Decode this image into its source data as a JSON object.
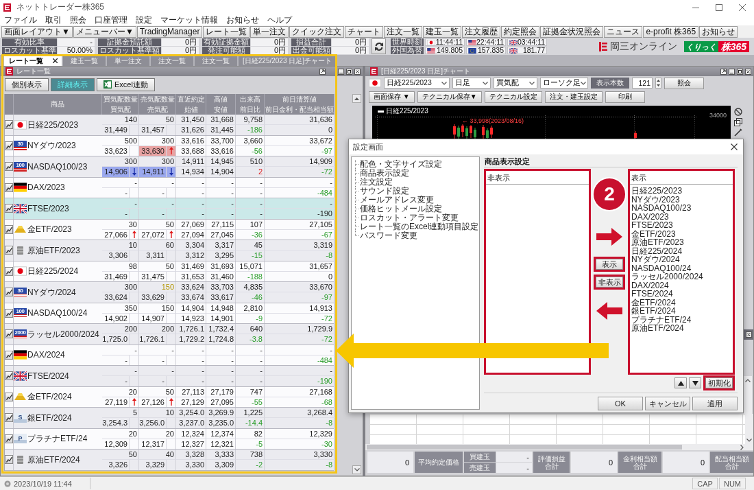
{
  "window": {
    "title": "ネットトレーダー株365"
  },
  "menu": [
    "ファイル",
    "取引",
    "照会",
    "口座管理",
    "設定",
    "マーケット情報",
    "お知らせ",
    "ヘルプ"
  ],
  "toolbar": [
    "画面レイアウト▼",
    "メニューバー▼",
    "TradingManager",
    "レート一覧",
    "単一注文",
    "クイック注文",
    "チャート",
    "注文一覧",
    "建玉一覧",
    "注文履歴",
    "約定照会",
    "証拠金状況照会",
    "ニュース",
    "e-profit 株365",
    "お知らせ"
  ],
  "account": [
    {
      "label": "有効比率",
      "value": "-"
    },
    {
      "label": "証拠金預託額",
      "value": "0円"
    },
    {
      "label": "有効証拠金額",
      "value": "0円"
    },
    {
      "label": "損益合計",
      "value": "0円"
    },
    {
      "label": "ロスカット基準",
      "value": "50.00%"
    },
    {
      "label": "ロスカット基準額",
      "value": "0円"
    },
    {
      "label": "発注可能額",
      "value": "0円"
    },
    {
      "label": "出金可能額",
      "value": "0円"
    }
  ],
  "world_clock": {
    "label": "世界時刻",
    "items": [
      {
        "kind": "japan",
        "value": "11:44:11"
      },
      {
        "kind": "usa",
        "value": "22:44:11"
      },
      {
        "kind": "uk",
        "value": "03:44:11"
      }
    ]
  },
  "forex": {
    "label": "外国為替",
    "items": [
      {
        "kind": "usa",
        "value": "149.805"
      },
      {
        "kind": "eu",
        "value": "157.835"
      },
      {
        "kind": "uk",
        "value": "181.77"
      }
    ]
  },
  "brand": {
    "name": "岡三オンライン",
    "product_prefix": "くりっく",
    "product_name": "株365"
  },
  "tabs": [
    {
      "label": "レート一覧",
      "selected": true,
      "closable": true
    },
    {
      "label": "建玉一覧",
      "selected": false,
      "closable": false
    },
    {
      "label": "単一注文",
      "selected": false,
      "closable": false
    },
    {
      "label": "注文一覧",
      "selected": false,
      "closable": false
    },
    {
      "label": "注文一覧",
      "selected": false,
      "closable": false
    },
    {
      "label": "[日経225/2023 日足]チャート",
      "selected": false,
      "closable": false
    }
  ],
  "rate_window": {
    "title": "レート一覧",
    "view_buttons": [
      {
        "label": "個別表示",
        "selected": false
      },
      {
        "label": "詳細表示",
        "selected": true
      }
    ],
    "excel_button": "Excel連動",
    "columns": [
      {
        "top": "商品"
      },
      {
        "top": "買気配数量",
        "bottom": "買気配"
      },
      {
        "top": "売気配数量",
        "bottom": "売気配"
      },
      {
        "top": "直近約定",
        "bottom": "始値"
      },
      {
        "top": "高値",
        "bottom": "安値"
      },
      {
        "top": "出来高",
        "bottom": "前日比"
      },
      {
        "top": "前日清算値",
        "bottom": "前日金利・配当相当額"
      }
    ],
    "rows": [
      {
        "name": "日経225/2023",
        "flag": {
          "kind": "japan"
        },
        "selected": false,
        "bid_qty": "140",
        "ask_qty": "50",
        "ask_qty_flash": false,
        "last": "31,450",
        "high": "31,668",
        "volume": "9,758",
        "prev_settle": "31,636",
        "bid": {
          "value": "31,449",
          "rising": false,
          "falling": false,
          "flashing": false
        },
        "ask": {
          "value": "31,457",
          "rising": false,
          "falling": false,
          "flashing": false
        },
        "open": "31,626",
        "low": "31,445",
        "change": {
          "value": "-186",
          "rising": false,
          "falling": true
        },
        "interest": {
          "value": "0",
          "rising": false,
          "falling": false
        }
      },
      {
        "name": "NYダウ/2023",
        "flag": {
          "kind": "usa_index",
          "label": "30"
        },
        "selected": false,
        "bid_qty": "500",
        "ask_qty": "300",
        "ask_qty_flash": false,
        "last": "33,616",
        "high": "33,700",
        "volume": "3,660",
        "prev_settle": "33,672",
        "bid": {
          "value": "33,623",
          "rising": false,
          "falling": false,
          "flashing": false
        },
        "ask": {
          "value": "33,630",
          "rising": true,
          "falling": false,
          "flashing": true
        },
        "open": "33,688",
        "low": "33,616",
        "change": {
          "value": "-56",
          "rising": false,
          "falling": true
        },
        "interest": {
          "value": "-97",
          "rising": false,
          "falling": true
        }
      },
      {
        "name": "NASDAQ100/23",
        "flag": {
          "kind": "usa_index",
          "label": "100"
        },
        "selected": false,
        "bid_qty": "300",
        "ask_qty": "300",
        "ask_qty_flash": false,
        "last": "14,911",
        "high": "14,945",
        "volume": "510",
        "prev_settle": "14,909",
        "bid": {
          "value": "14,906",
          "rising": false,
          "falling": true,
          "flashing": true
        },
        "ask": {
          "value": "14,911",
          "rising": false,
          "falling": true,
          "flashing": true
        },
        "open": "14,934",
        "low": "14,904",
        "change": {
          "value": "2",
          "rising": true,
          "falling": false
        },
        "interest": {
          "value": "-72",
          "rising": false,
          "falling": true
        }
      },
      {
        "name": "DAX/2023",
        "flag": {
          "kind": "germany"
        },
        "selected": false,
        "bid_qty": "-",
        "ask_qty": "-",
        "ask_qty_flash": false,
        "last": "-",
        "high": "-",
        "volume": "-",
        "prev_settle": "-",
        "bid": {
          "value": "-",
          "rising": false,
          "falling": false,
          "flashing": false
        },
        "ask": {
          "value": "-",
          "rising": false,
          "falling": false,
          "flashing": false
        },
        "open": "-",
        "low": "-",
        "change": {
          "value": "-",
          "rising": false,
          "falling": false
        },
        "interest": {
          "value": "-484",
          "rising": false,
          "falling": true
        }
      },
      {
        "name": "FTSE/2023",
        "flag": {
          "kind": "uk"
        },
        "selected": true,
        "bid_qty": "-",
        "ask_qty": "-",
        "ask_qty_flash": false,
        "last": "-",
        "high": "-",
        "volume": "-",
        "prev_settle": "-",
        "bid": {
          "value": "-",
          "rising": false,
          "falling": false,
          "flashing": false
        },
        "ask": {
          "value": "-",
          "rising": false,
          "falling": false,
          "flashing": false
        },
        "open": "-",
        "low": "-",
        "change": {
          "value": "-",
          "rising": false,
          "falling": false
        },
        "interest": {
          "value": "-190",
          "rising": false,
          "falling": false
        }
      },
      {
        "name": "金ETF/2023",
        "flag": {
          "kind": "gold"
        },
        "selected": false,
        "bid_qty": "30",
        "ask_qty": "50",
        "ask_qty_flash": false,
        "last": "27,069",
        "high": "27,115",
        "volume": "107",
        "prev_settle": "27,105",
        "bid": {
          "value": "27,066",
          "rising": true,
          "falling": false,
          "flashing": false
        },
        "ask": {
          "value": "27,072",
          "rising": true,
          "falling": false,
          "flashing": false
        },
        "open": "27,094",
        "low": "27,045",
        "change": {
          "value": "-36",
          "rising": false,
          "falling": true
        },
        "interest": {
          "value": "-67",
          "rising": false,
          "falling": true
        }
      },
      {
        "name": "原油ETF/2023",
        "flag": {
          "kind": "oil"
        },
        "selected": false,
        "bid_qty": "10",
        "ask_qty": "60",
        "ask_qty_flash": false,
        "last": "3,304",
        "high": "3,317",
        "volume": "45",
        "prev_settle": "3,319",
        "bid": {
          "value": "3,306",
          "rising": false,
          "falling": false,
          "flashing": false
        },
        "ask": {
          "value": "3,311",
          "rising": false,
          "falling": false,
          "flashing": false
        },
        "open": "3,312",
        "low": "3,295",
        "change": {
          "value": "-15",
          "rising": false,
          "falling": true
        },
        "interest": {
          "value": "-8",
          "rising": false,
          "falling": true
        }
      },
      {
        "name": "日経225/2024",
        "flag": {
          "kind": "japan"
        },
        "selected": false,
        "bid_qty": "98",
        "ask_qty": "50",
        "ask_qty_flash": false,
        "last": "31,469",
        "high": "31,693",
        "volume": "15,071",
        "prev_settle": "31,657",
        "bid": {
          "value": "31,469",
          "rising": false,
          "falling": false,
          "flashing": false
        },
        "ask": {
          "value": "31,475",
          "rising": false,
          "falling": false,
          "flashing": false
        },
        "open": "31,653",
        "low": "31,460",
        "change": {
          "value": "-188",
          "rising": false,
          "falling": true
        },
        "interest": {
          "value": "0",
          "rising": false,
          "falling": false
        }
      },
      {
        "name": "NYダウ/2024",
        "flag": {
          "kind": "usa_index",
          "label": "30"
        },
        "selected": false,
        "bid_qty": "300",
        "ask_qty": "150",
        "ask_qty_flash": true,
        "last": "33,624",
        "high": "33,703",
        "volume": "4,835",
        "prev_settle": "33,670",
        "bid": {
          "value": "33,624",
          "rising": false,
          "falling": false,
          "flashing": false
        },
        "ask": {
          "value": "33,629",
          "rising": false,
          "falling": false,
          "flashing": false
        },
        "open": "33,674",
        "low": "33,617",
        "change": {
          "value": "-46",
          "rising": false,
          "falling": true
        },
        "interest": {
          "value": "-97",
          "rising": false,
          "falling": true
        }
      },
      {
        "name": "NASDAQ100/24",
        "flag": {
          "kind": "usa_index",
          "label": "100"
        },
        "selected": false,
        "bid_qty": "350",
        "ask_qty": "150",
        "ask_qty_flash": false,
        "last": "14,904",
        "high": "14,948",
        "volume": "2,810",
        "prev_settle": "14,913",
        "bid": {
          "value": "14,902",
          "rising": false,
          "falling": false,
          "flashing": false
        },
        "ask": {
          "value": "14,907",
          "rising": false,
          "falling": false,
          "flashing": false
        },
        "open": "14,923",
        "low": "14,901",
        "change": {
          "value": "-9",
          "rising": false,
          "falling": true
        },
        "interest": {
          "value": "-72",
          "rising": false,
          "falling": true
        }
      },
      {
        "name": "ラッセル2000/2024",
        "flag": {
          "kind": "usa_index",
          "label": "2000"
        },
        "selected": false,
        "bid_qty": "200",
        "ask_qty": "200",
        "ask_qty_flash": false,
        "last": "1,726.1",
        "high": "1,732.4",
        "volume": "640",
        "prev_settle": "1,729.9",
        "bid": {
          "value": "1,725.0",
          "rising": false,
          "falling": false,
          "flashing": false
        },
        "ask": {
          "value": "1,726.1",
          "rising": false,
          "falling": false,
          "flashing": false
        },
        "open": "1,729.2",
        "low": "1,724.8",
        "change": {
          "value": "-3.8",
          "rising": false,
          "falling": true
        },
        "interest": {
          "value": "-72",
          "rising": false,
          "falling": true
        }
      },
      {
        "name": "DAX/2024",
        "flag": {
          "kind": "germany"
        },
        "selected": false,
        "bid_qty": "-",
        "ask_qty": "-",
        "ask_qty_flash": false,
        "last": "-",
        "high": "-",
        "volume": "-",
        "prev_settle": "-",
        "bid": {
          "value": "-",
          "rising": false,
          "falling": false,
          "flashing": false
        },
        "ask": {
          "value": "-",
          "rising": false,
          "falling": false,
          "flashing": false
        },
        "open": "-",
        "low": "-",
        "change": {
          "value": "-",
          "rising": false,
          "falling": false
        },
        "interest": {
          "value": "-484",
          "rising": false,
          "falling": true
        }
      },
      {
        "name": "FTSE/2024",
        "flag": {
          "kind": "uk"
        },
        "selected": false,
        "bid_qty": "-",
        "ask_qty": "-",
        "ask_qty_flash": false,
        "last": "-",
        "high": "-",
        "volume": "-",
        "prev_settle": "-",
        "bid": {
          "value": "-",
          "rising": false,
          "falling": false,
          "flashing": false
        },
        "ask": {
          "value": "-",
          "rising": false,
          "falling": false,
          "flashing": false
        },
        "open": "-",
        "low": "-",
        "change": {
          "value": "-",
          "rising": false,
          "falling": false
        },
        "interest": {
          "value": "-190",
          "rising": false,
          "falling": true
        }
      },
      {
        "name": "金ETF/2024",
        "flag": {
          "kind": "gold"
        },
        "selected": false,
        "bid_qty": "20",
        "ask_qty": "50",
        "ask_qty_flash": false,
        "last": "27,113",
        "high": "27,179",
        "volume": "747",
        "prev_settle": "27,168",
        "bid": {
          "value": "27,119",
          "rising": true,
          "falling": false,
          "flashing": false
        },
        "ask": {
          "value": "27,126",
          "rising": true,
          "falling": false,
          "flashing": false
        },
        "open": "27,129",
        "low": "27,095",
        "change": {
          "value": "-55",
          "rising": false,
          "falling": true
        },
        "interest": {
          "value": "-68",
          "rising": false,
          "falling": true
        }
      },
      {
        "name": "銀ETF/2024",
        "flag": {
          "kind": "metal",
          "label": "S"
        },
        "selected": false,
        "bid_qty": "5",
        "ask_qty": "10",
        "ask_qty_flash": false,
        "last": "3,254.0",
        "high": "3,269.9",
        "volume": "1,225",
        "prev_settle": "3,268.4",
        "bid": {
          "value": "3,254.3",
          "rising": false,
          "falling": false,
          "flashing": false
        },
        "ask": {
          "value": "3,256.0",
          "rising": false,
          "falling": false,
          "flashing": false
        },
        "open": "3,237.0",
        "low": "3,235.0",
        "change": {
          "value": "-14.4",
          "rising": false,
          "falling": true
        },
        "interest": {
          "value": "-8",
          "rising": false,
          "falling": true
        }
      },
      {
        "name": "プラチナETF/24",
        "flag": {
          "kind": "metal",
          "label": "P"
        },
        "selected": false,
        "bid_qty": "20",
        "ask_qty": "20",
        "ask_qty_flash": false,
        "last": "12,324",
        "high": "12,374",
        "volume": "82",
        "prev_settle": "12,329",
        "bid": {
          "value": "12,309",
          "rising": false,
          "falling": false,
          "flashing": false
        },
        "ask": {
          "value": "12,317",
          "rising": false,
          "falling": false,
          "flashing": false
        },
        "open": "12,327",
        "low": "12,321",
        "change": {
          "value": "-5",
          "rising": false,
          "falling": true
        },
        "interest": {
          "value": "-30",
          "rising": false,
          "falling": true
        }
      },
      {
        "name": "原油ETF/2024",
        "flag": {
          "kind": "oil"
        },
        "selected": false,
        "bid_qty": "50",
        "ask_qty": "40",
        "ask_qty_flash": false,
        "last": "3,328",
        "high": "3,333",
        "volume": "738",
        "prev_settle": "3,330",
        "bid": {
          "value": "3,326",
          "rising": false,
          "falling": false,
          "flashing": false
        },
        "ask": {
          "value": "3,329",
          "rising": false,
          "falling": false,
          "flashing": false
        },
        "open": "3,330",
        "low": "3,309",
        "change": {
          "value": "-2",
          "rising": false,
          "falling": true
        },
        "interest": {
          "value": "-8",
          "rising": false,
          "falling": true
        }
      }
    ]
  },
  "chart_window": {
    "title": "[日経225/2023 日足]チャート",
    "symbol": {
      "kind": "japan",
      "value": "日経225/2023"
    },
    "selects": [
      "日足",
      "買気配",
      "ローソク足"
    ],
    "count_label": "表示本数",
    "count": "121",
    "query_button": "照会",
    "buttons": [
      "画面保存 ▼",
      "テクニカル保存▼",
      "テクニカル設定",
      "注文・建玉設定",
      "印刷"
    ],
    "legend": "日経225/2023",
    "axis_label": "34000",
    "note": "← 33,998(2023/08/16)"
  },
  "position_summary": [
    {
      "kind": "value",
      "text": "0"
    },
    {
      "kind": "label",
      "text": "平均約定価格"
    },
    {
      "kind": "sides",
      "items": [
        {
          "label": "買建玉",
          "value": "-"
        },
        {
          "label": "売建玉",
          "value": "-"
        }
      ]
    },
    {
      "kind": "total_label",
      "text": "評価損益合計"
    },
    {
      "kind": "value",
      "text": "0"
    },
    {
      "kind": "total_label",
      "text": "金利相当額合計"
    },
    {
      "kind": "value",
      "text": "0"
    },
    {
      "kind": "total_label",
      "text": "配当相当額合計"
    }
  ],
  "settings_dialog": {
    "title": "設定画面",
    "tree": [
      "配色・文字サイズ設定",
      "商品表示設定",
      "注文設定",
      "サウンド設定",
      "メールアドレス変更",
      "価格ヒットメール設定",
      "ロスカット・アラート変更",
      "レート一覧のExcel連動項目設定",
      "パスワード変更"
    ],
    "heading": "商品表示設定",
    "hidden_list": {
      "header": "非表示",
      "highlighted": true
    },
    "shown_list": {
      "header": "表示",
      "highlighted": true,
      "items": [
        "日経225/2023",
        "NYダウ/2023",
        "NASDAQ100/23",
        "DAX/2023",
        "FTSE/2023",
        "金ETF/2023",
        "原油ETF/2023",
        "日経225/2024",
        "NYダウ/2024",
        "NASDAQ100/24",
        "ラッセル2000/2024",
        "DAX/2024",
        "FTSE/2024",
        "金ETF/2024",
        "銀ETF/2024",
        "プラチナETF/24",
        "原油ETF/2024"
      ]
    },
    "step": "2",
    "move_buttons": [
      {
        "label": "表示",
        "highlighted": true
      },
      {
        "label": "非表示",
        "highlighted": true
      }
    ],
    "reset_button": {
      "label": "初期化",
      "highlighted": true
    },
    "footer_buttons": [
      "OK",
      "キャンセル",
      "適用"
    ]
  },
  "status_bar": {
    "datetime": "2023/10/19 11:44",
    "indicators": [
      "CAP",
      "NUM"
    ]
  }
}
